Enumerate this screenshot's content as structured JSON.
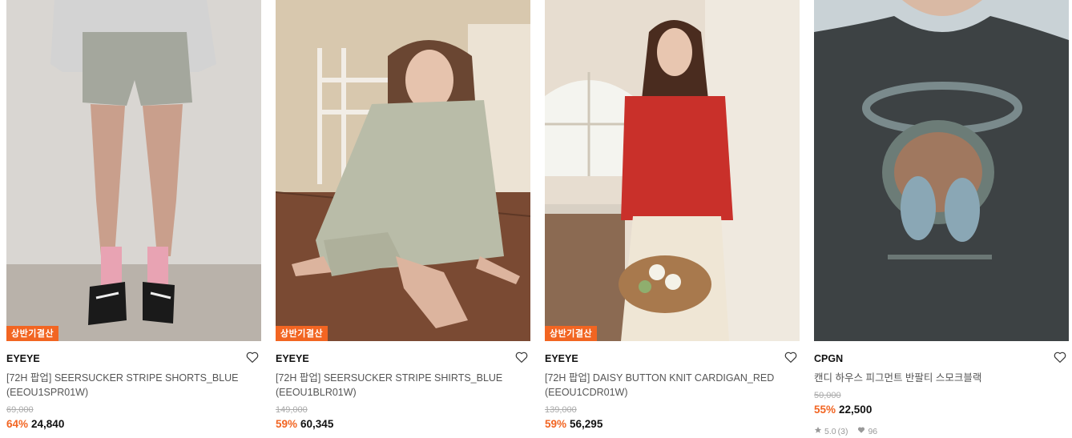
{
  "products": [
    {
      "badge": "상반기결산",
      "brand": "EYEYE",
      "title": "[72H 팝업] SEERSUCKER STRIPE SHORTS_BLUE (EEOU1SPR01W)",
      "original_price": "69,000",
      "discount": "64%",
      "price": "24,840"
    },
    {
      "badge": "상반기결산",
      "brand": "EYEYE",
      "title": "[72H 팝업] SEERSUCKER STRIPE SHIRTS_BLUE (EEOU1BLR01W)",
      "original_price": "149,000",
      "discount": "59%",
      "price": "60,345"
    },
    {
      "badge": "상반기결산",
      "brand": "EYEYE",
      "title": "[72H 팝업] DAISY BUTTON KNIT CARDIGAN_RED (EEOU1CDR01W)",
      "original_price": "139,000",
      "discount": "59%",
      "price": "56,295"
    },
    {
      "brand": "CPGN",
      "title": "캔디 하우스 피그먼트 반팔티 스모크블랙",
      "original_price": "50,000",
      "discount": "55%",
      "price": "22,500",
      "rating": "5.0",
      "review_count": "(3)",
      "likes": "96"
    }
  ],
  "icons": {
    "heart": "heart-outline-icon",
    "star": "star-icon",
    "likes": "heart-filled-icon"
  },
  "colors": {
    "accent": "#f26522",
    "text": "#111111",
    "muted": "#999999"
  }
}
